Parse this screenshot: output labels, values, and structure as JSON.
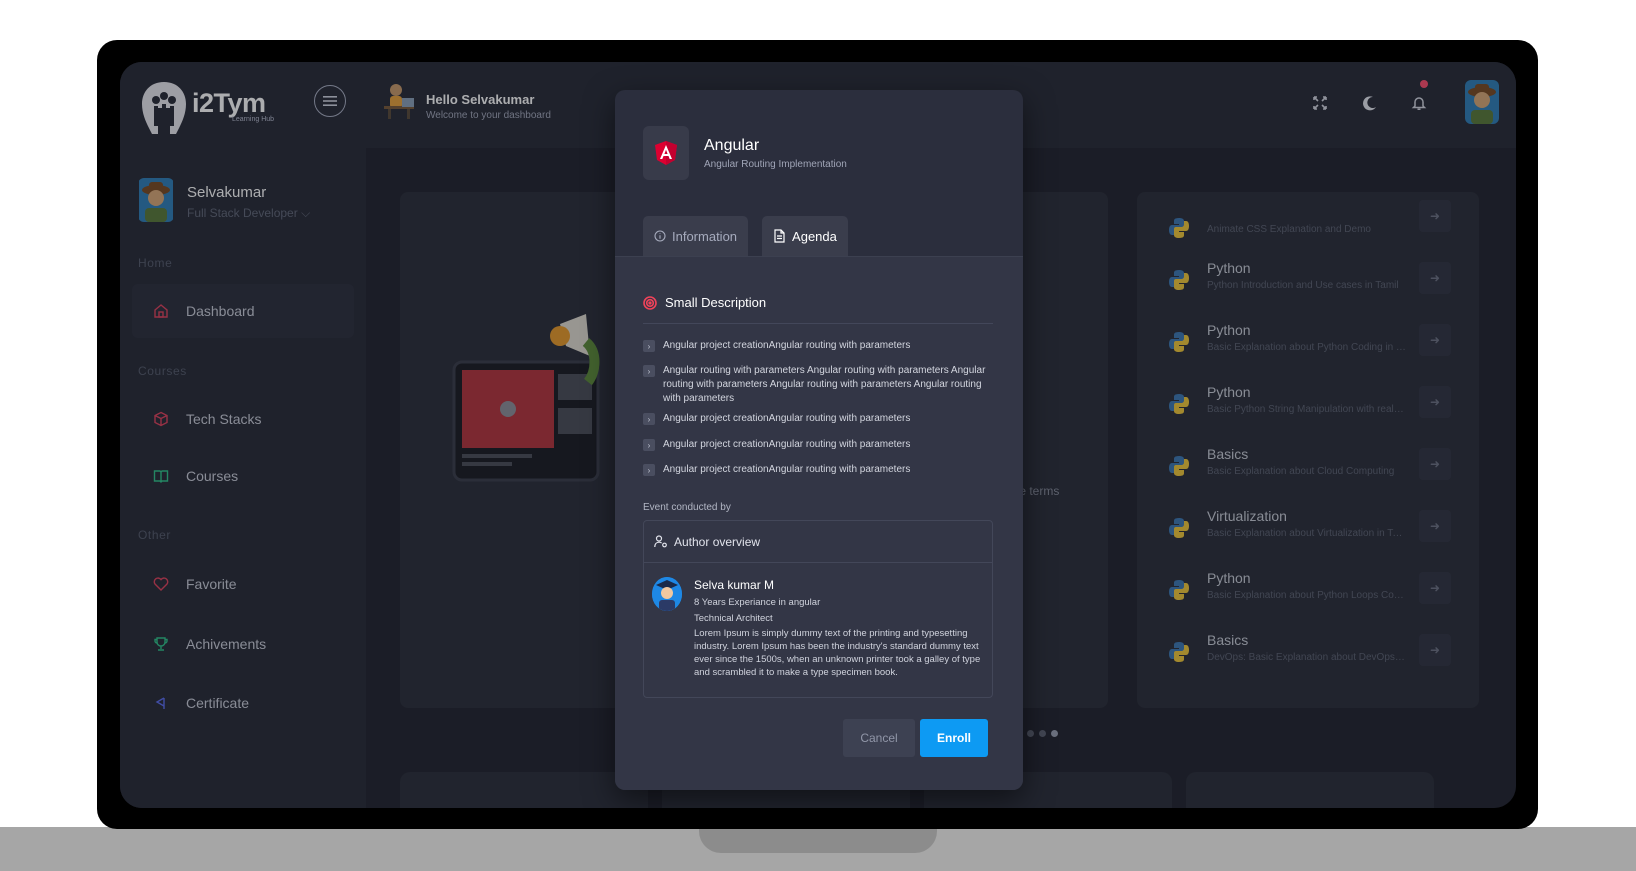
{
  "brand": {
    "name": "i2Tym",
    "tagline": "Learning Hub"
  },
  "header": {
    "greeting": "Hello Selvakumar",
    "subtitle": "Welcome to your dashboard"
  },
  "user": {
    "name": "Selvakumar",
    "role": "Full Stack Developer"
  },
  "sidebar": {
    "sections": [
      {
        "title": "Home",
        "items": [
          {
            "label": "Dashboard",
            "active": true
          }
        ]
      },
      {
        "title": "Courses",
        "items": [
          {
            "label": "Tech Stacks"
          },
          {
            "label": "Courses"
          }
        ]
      },
      {
        "title": "Other",
        "items": [
          {
            "label": "Favorite"
          },
          {
            "label": "Achivements"
          },
          {
            "label": "Certificate"
          }
        ]
      }
    ]
  },
  "banner": {
    "text_fragment": "mple terms"
  },
  "course_list": [
    {
      "title": "",
      "subtitle": "Animate CSS Explanation and Demo"
    },
    {
      "title": "Python",
      "subtitle": "Python Introduction and Use cases in Tamil"
    },
    {
      "title": "Python",
      "subtitle": "Basic Explanation about Python Coding in Tamil"
    },
    {
      "title": "Python",
      "subtitle": "Basic Python String Manipulation with real-tim..."
    },
    {
      "title": "Basics",
      "subtitle": "Basic Explanation about Cloud Computing"
    },
    {
      "title": "Virtualization",
      "subtitle": "Basic Explanation about Virtualization in Tamil"
    },
    {
      "title": "Python",
      "subtitle": "Basic Explanation about Python Loops Conce..."
    },
    {
      "title": "Basics",
      "subtitle": "DevOps: Basic Explanation about DevOps Intr..."
    }
  ],
  "modal": {
    "title": "Angular",
    "subtitle": "Angular Routing Implementation",
    "tabs": [
      {
        "label": "Information",
        "active": false
      },
      {
        "label": "Agenda",
        "active": true
      }
    ],
    "section_title": "Small Description",
    "bullets": [
      "Angular project creationAngular routing with parameters",
      "Angular routing with parameters Angular routing with parameters Angular routing with parameters Angular routing with parameters Angular routing with parameters",
      "Angular project creationAngular routing with parameters",
      "Angular project creationAngular routing with parameters",
      "Angular project creationAngular routing with parameters"
    ],
    "event_by_label": "Event conducted by",
    "author_heading": "Author overview",
    "author": {
      "name": "Selva kumar M",
      "experience": "8 Years Experiance in angular",
      "role": "Technical Architect",
      "bio": "Lorem Ipsum is simply dummy text of the printing and typesetting industry. Lorem Ipsum has been the industry's standard dummy text ever since the 1500s, when an unknown printer took a galley of type and scrambled it to make a type specimen book."
    },
    "cancel_label": "Cancel",
    "enroll_label": "Enroll"
  },
  "icons": {
    "fullscreen": "fullscreen-icon",
    "theme": "moon-icon",
    "notifications": "bell-icon"
  },
  "colors": {
    "accent": "#0d9af3",
    "angular_red": "#dd0031",
    "notif": "#ff4d6d"
  }
}
